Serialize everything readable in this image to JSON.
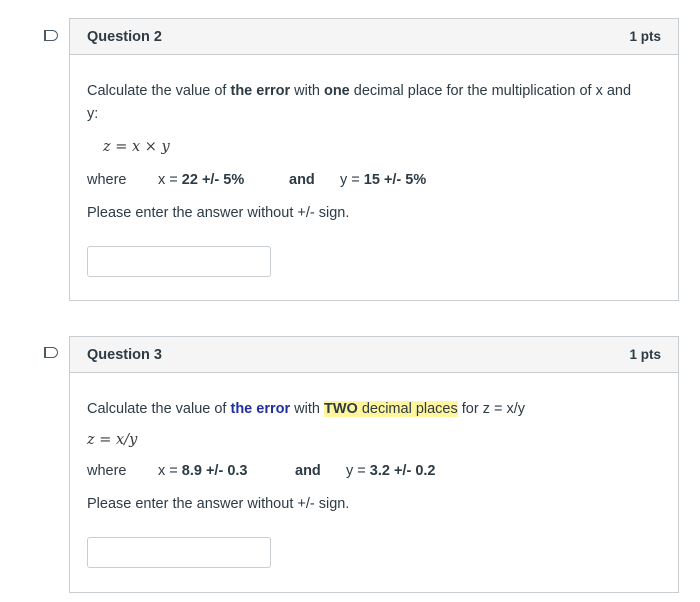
{
  "questions": [
    {
      "title": "Question 2",
      "points": "1 pts",
      "prompt_pre": "Calculate the value of ",
      "prompt_em1": "the error",
      "prompt_mid": " with ",
      "prompt_em2": "one",
      "prompt_post1": " decimal place for the multiplication of x and",
      "prompt_post2": "y:",
      "formula": "z = x × y",
      "where": "where",
      "x_label": "x = ",
      "x_value": "22 +/- 5%",
      "and": "and",
      "y_label": "y = ",
      "y_value": "15 +/- 5%",
      "instruction": "Please enter the answer without +/- sign.",
      "answer": ""
    },
    {
      "title": "Question 3",
      "points": "1 pts",
      "prompt_pre": "Calculate the value of ",
      "prompt_em1": "the error",
      "prompt_mid": " with ",
      "prompt_em2": "TWO",
      "prompt_em3": " decimal places",
      "prompt_post1": " for z = x/y",
      "formula": "z = x/y",
      "where": "where",
      "x_label": "x = ",
      "x_value": "8.9 +/- 0.3",
      "and": "and",
      "y_label": "y = ",
      "y_value": "3.2 +/- 0.2",
      "instruction": "Please enter the answer without +/- sign.",
      "answer": ""
    }
  ]
}
